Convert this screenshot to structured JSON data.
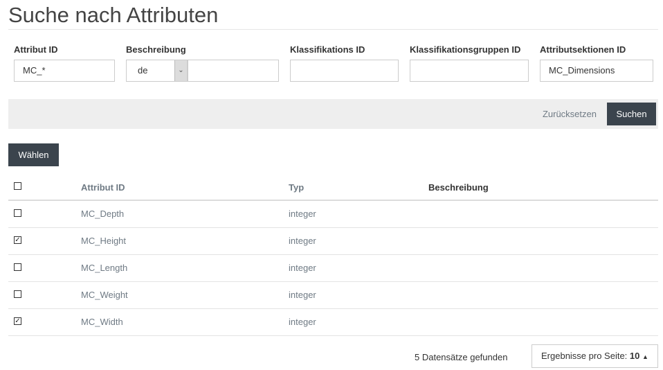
{
  "page": {
    "title": "Suche nach Attributen"
  },
  "filters": {
    "attribut_id": {
      "label": "Attribut ID",
      "value": "MC_*"
    },
    "beschreibung": {
      "label": "Beschreibung",
      "language": "de",
      "value": ""
    },
    "klassifikations_id": {
      "label": "Klassifikations ID",
      "value": ""
    },
    "klassifikationsgruppen_id": {
      "label": "Klassifikationsgruppen ID",
      "value": ""
    },
    "attributsektionen_id": {
      "label": "Attributsektionen ID",
      "value": "MC_Dimensions"
    }
  },
  "actions": {
    "reset_label": "Zurücksetzen",
    "search_label": "Suchen",
    "choose_label": "Wählen"
  },
  "table": {
    "headers": {
      "id": "Attribut ID",
      "typ": "Typ",
      "desc": "Beschreibung"
    },
    "rows": [
      {
        "id": "MC_Depth",
        "typ": "integer",
        "desc": "",
        "checked": false
      },
      {
        "id": "MC_Height",
        "typ": "integer",
        "desc": "",
        "checked": true
      },
      {
        "id": "MC_Length",
        "typ": "integer",
        "desc": "",
        "checked": false
      },
      {
        "id": "MC_Weight",
        "typ": "integer",
        "desc": "",
        "checked": false
      },
      {
        "id": "MC_Width",
        "typ": "integer",
        "desc": "",
        "checked": true
      }
    ]
  },
  "footer": {
    "count_text": "5 Datensätze gefunden",
    "per_page_label": "Ergebnisse pro Seite:",
    "per_page_value": "10"
  }
}
